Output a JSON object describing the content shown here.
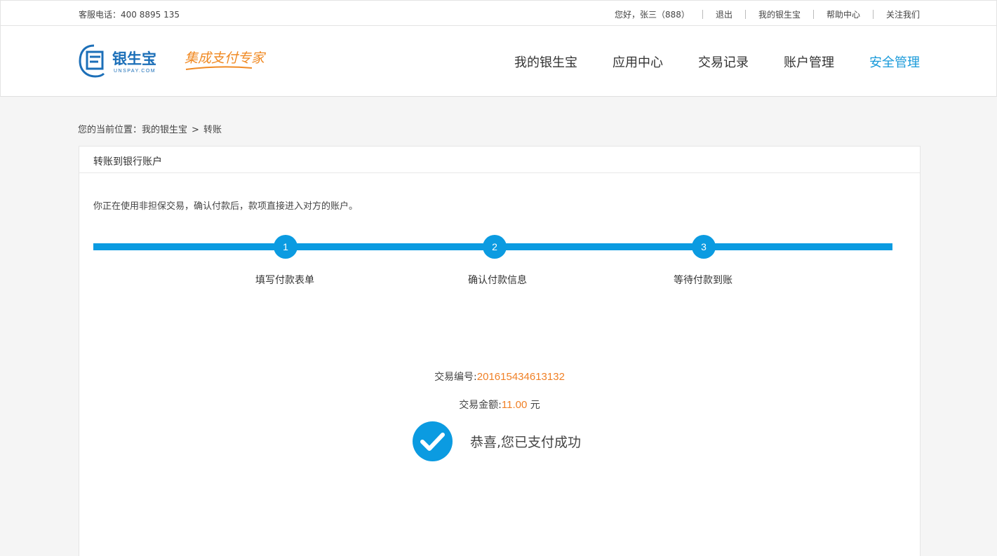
{
  "topbar": {
    "hotline": "客服电话：400 8895 135",
    "greeting": "您好，张三（888）",
    "logout": "退出",
    "my_account": "我的银生宝",
    "help": "帮助中心",
    "follow": "关注我们"
  },
  "header": {
    "logo_text": "银生宝",
    "logo_sub": "UNSPAY.COM",
    "slogan": "集成支付专家",
    "nav": [
      "我的银生宝",
      "应用中心",
      "交易记录",
      "账户管理",
      "安全管理"
    ],
    "active_nav": "安全管理"
  },
  "breadcrumb": {
    "prefix": "您的当前位置：",
    "level1": "我的银生宝",
    "separator": ">",
    "level2": "转账"
  },
  "panel": {
    "title": "转账到银行账户",
    "notice": "你正在使用非担保交易，确认付款后，款项直接进入对方的账户。"
  },
  "steps": [
    {
      "num": "1",
      "label": "填写付款表单"
    },
    {
      "num": "2",
      "label": "确认付款信息"
    },
    {
      "num": "3",
      "label": "等待付款到账"
    }
  ],
  "result": {
    "trade_no_label": "交易编号:",
    "trade_no": "201615434613132",
    "amount_label": "交易金额:",
    "amount": "11.00",
    "amount_unit": "元",
    "message": "恭喜,您已支付成功"
  },
  "colors": {
    "accent": "#0b9be1",
    "nav_active": "#199ad9",
    "highlight": "#f08026",
    "logo_blue": "#1c6fb8",
    "slogan_orange": "#f08a24"
  }
}
